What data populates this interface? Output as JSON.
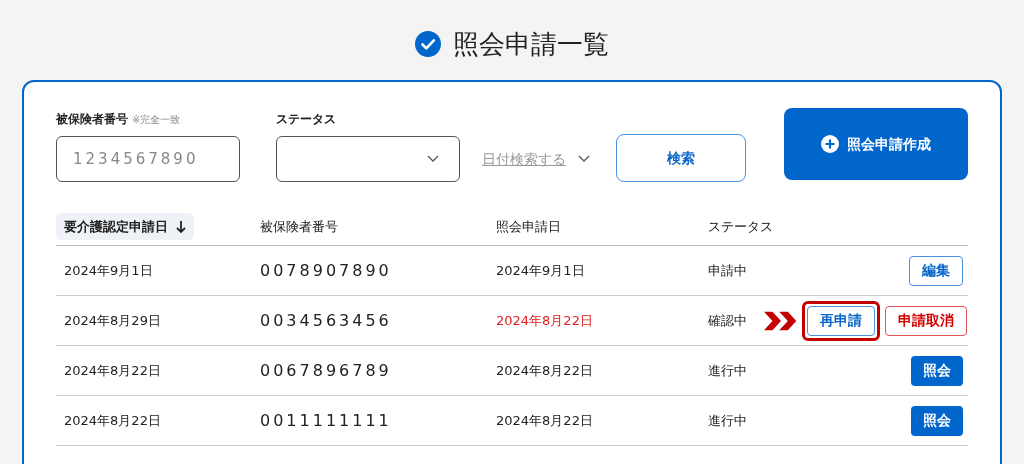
{
  "page_title": "照会申請一覧",
  "filters": {
    "insured_label": "被保険者番号",
    "insured_note": "※完全一致",
    "insured_placeholder": "1234567890",
    "status_label": "ステータス",
    "date_toggle": "日付検索する",
    "search_button": "検索",
    "create_button": "照会申請作成"
  },
  "table": {
    "columns": [
      {
        "label": "要介護認定申請日",
        "sorted": true
      },
      {
        "label": "被保険者番号",
        "sorted": false
      },
      {
        "label": "照会申請日",
        "sorted": false
      },
      {
        "label": "ステータス",
        "sorted": false
      }
    ],
    "rows": [
      {
        "application_date": "2024年9月1日",
        "insured_number": "0078907890",
        "inquiry_date": "2024年9月1日",
        "overdue": false,
        "status": "申請中",
        "actions": [
          {
            "label": "編集",
            "kind": "outline",
            "highlighted": false
          }
        ]
      },
      {
        "application_date": "2024年8月29日",
        "insured_number": "0034563456",
        "inquiry_date": "2024年8月22日",
        "overdue": true,
        "status": "確認中",
        "actions": [
          {
            "label": "再申請",
            "kind": "outline",
            "highlighted": true
          },
          {
            "label": "申請取消",
            "kind": "danger",
            "highlighted": false
          }
        ]
      },
      {
        "application_date": "2024年8月22日",
        "insured_number": "0067896789",
        "inquiry_date": "2024年8月22日",
        "overdue": false,
        "status": "進行中",
        "actions": [
          {
            "label": "照会",
            "kind": "filled",
            "highlighted": false
          }
        ]
      },
      {
        "application_date": "2024年8月22日",
        "insured_number": "0011111111",
        "inquiry_date": "2024年8月22日",
        "overdue": false,
        "status": "進行中",
        "actions": [
          {
            "label": "照会",
            "kind": "filled",
            "highlighted": false
          }
        ]
      }
    ]
  }
}
